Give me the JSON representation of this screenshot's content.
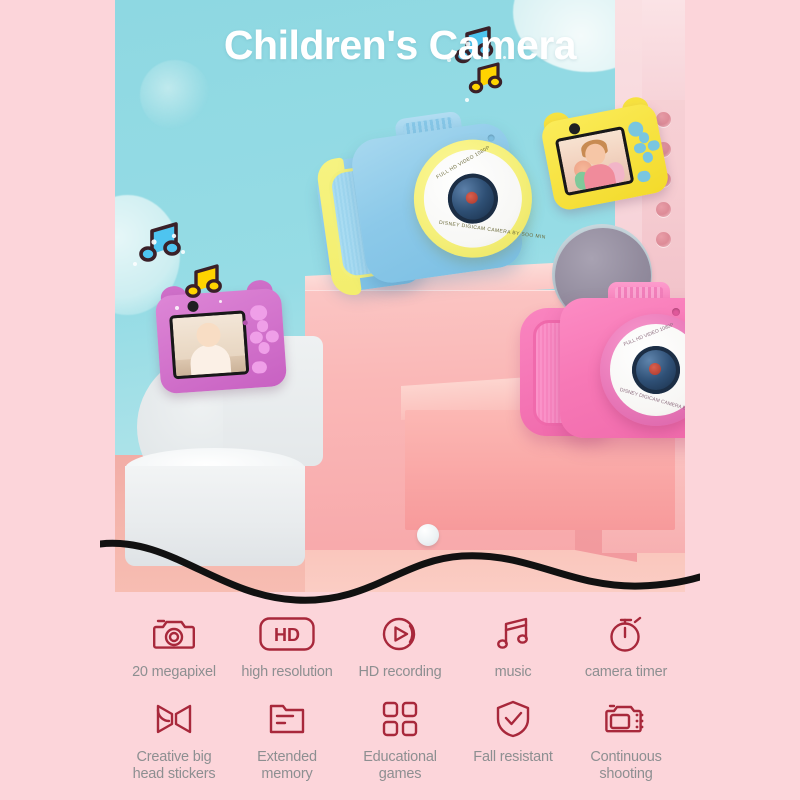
{
  "theme": {
    "page_background": "#fcd5da",
    "hero_background": "#8ed8e2",
    "icon_color": "#a8283b",
    "label_color": "#8d8f91",
    "title_color": "#ffffff"
  },
  "header": {
    "title": "Children's Camera"
  },
  "hero": {
    "products": [
      {
        "name": "blue-camera",
        "color": "#8cc9e9",
        "accent": "#f3ee6d",
        "view": "front",
        "lens_ring_text_top": "FULL HD VIDEO 1080P",
        "lens_ring_text_bottom": "DISNEY DIGICAM CAMERA BY SOO MIN"
      },
      {
        "name": "pink-camera",
        "color": "#f778b6",
        "accent": "#ffffff",
        "view": "front",
        "lens_ring_text_top": "FULL HD VIDEO 1080P",
        "lens_ring_text_bottom": "DISNEY DIGICAM CAMERA BY SOO MIN"
      },
      {
        "name": "yellow-camera",
        "color": "#f7e23f",
        "accent": "#79c6e0",
        "view": "back",
        "screen_content": "child-photo"
      },
      {
        "name": "purple-camera",
        "color": "#cf6fc9",
        "accent": "#e08fe0",
        "view": "back",
        "screen_content": "baby-photo"
      }
    ],
    "decorations": [
      {
        "name": "music-note-blue",
        "color": "#4ec4f0"
      },
      {
        "name": "music-note-yellow",
        "color": "#ffd400"
      },
      {
        "name": "music-note-blue-2",
        "color": "#4ec4f0"
      },
      {
        "name": "music-note-yellow-2",
        "color": "#ffd400"
      }
    ]
  },
  "features": {
    "row1": [
      {
        "label": "20 megapixel",
        "icon": "camera-icon"
      },
      {
        "label": "high resolution",
        "icon": "hd-badge-icon"
      },
      {
        "label": "HD recording",
        "icon": "play-circle-icon"
      },
      {
        "label": "music",
        "icon": "music-note-icon"
      },
      {
        "label": "camera timer",
        "icon": "stopwatch-icon"
      }
    ],
    "row2": [
      {
        "label": "Creative big\nhead stickers",
        "icon": "sticker-bowtie-icon"
      },
      {
        "label": "Extended\nmemory",
        "icon": "folder-icon"
      },
      {
        "label": "Educational\ngames",
        "icon": "grid-four-icon"
      },
      {
        "label": "Fall resistant",
        "icon": "shield-check-icon"
      },
      {
        "label": "Continuous\nshooting",
        "icon": "burst-camera-icon"
      }
    ]
  }
}
